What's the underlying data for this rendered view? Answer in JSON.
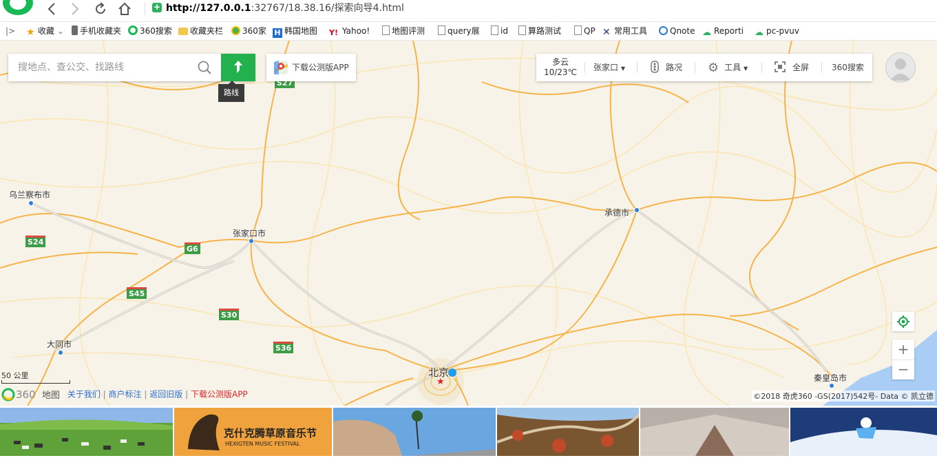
{
  "browser": {
    "url_host": "http://127.0.0.1",
    "url_rest": ":32767/18.38.16/探索向导4.html"
  },
  "bookmarks": [
    {
      "label": "收藏",
      "icon": "star-icon"
    },
    {
      "label": "手机收藏夹",
      "icon": "phone-icon"
    },
    {
      "label": "360搜索",
      "icon": "360-search-icon"
    },
    {
      "label": "收藏夹栏",
      "icon": "folder-icon"
    },
    {
      "label": "360家",
      "icon": "360-home-icon"
    },
    {
      "label": "韩国地图",
      "icon": "h-icon"
    },
    {
      "label": "Yahoo!",
      "icon": "yahoo-icon"
    },
    {
      "label": "地图评测",
      "icon": "page-icon"
    },
    {
      "label": "query展",
      "icon": "page-icon"
    },
    {
      "label": "id",
      "icon": "page-icon"
    },
    {
      "label": "算路测试",
      "icon": "page-icon"
    },
    {
      "label": "QP",
      "icon": "page-icon"
    },
    {
      "label": "常用工具",
      "icon": "tools-icon"
    },
    {
      "label": "Qnote",
      "icon": "qnote-icon"
    },
    {
      "label": "Reporti",
      "icon": "cloud-icon"
    },
    {
      "label": "pc-pvuv",
      "icon": "cloud-icon"
    }
  ],
  "search": {
    "placeholder": "搜地点、查公交、找路线",
    "route_tooltip": "路线",
    "app_label": "下载公测版APP"
  },
  "tools": {
    "weather_condition": "多云",
    "weather_temp": "10/23℃",
    "city": "张家口",
    "traffic": "路况",
    "tools": "工具",
    "fullscreen": "全屏",
    "search360": "360搜索"
  },
  "map": {
    "cities": [
      {
        "name": "乌兰察布市"
      },
      {
        "name": "张家口市"
      },
      {
        "name": "承德市"
      },
      {
        "name": "大同市"
      },
      {
        "name": "北京"
      },
      {
        "name": "秦皇岛市"
      }
    ],
    "road_signs": [
      "S27",
      "S24",
      "G6",
      "S45",
      "S30",
      "S36"
    ],
    "scale": "50 公里",
    "colors": {
      "land": "#f8f3e8",
      "road": "#f5b44a",
      "route_button": "#22b14c",
      "sea": "#a9cdf5"
    }
  },
  "footer": {
    "about": "关于我们",
    "merchant": "商户标注",
    "old_version": "返回旧版",
    "download": "下载公测版APP",
    "copyright": "©2018 奇虎360 -GS(2017)542号- Data © 凯立德"
  },
  "thumbnails": [
    {
      "caption": ""
    },
    {
      "caption": "克什克腾草原音乐节"
    },
    {
      "caption": ""
    },
    {
      "caption": ""
    },
    {
      "caption": ""
    },
    {
      "caption": ""
    }
  ],
  "thumb_sub": "HEXIGTEN MUSIC FESTIVAL"
}
